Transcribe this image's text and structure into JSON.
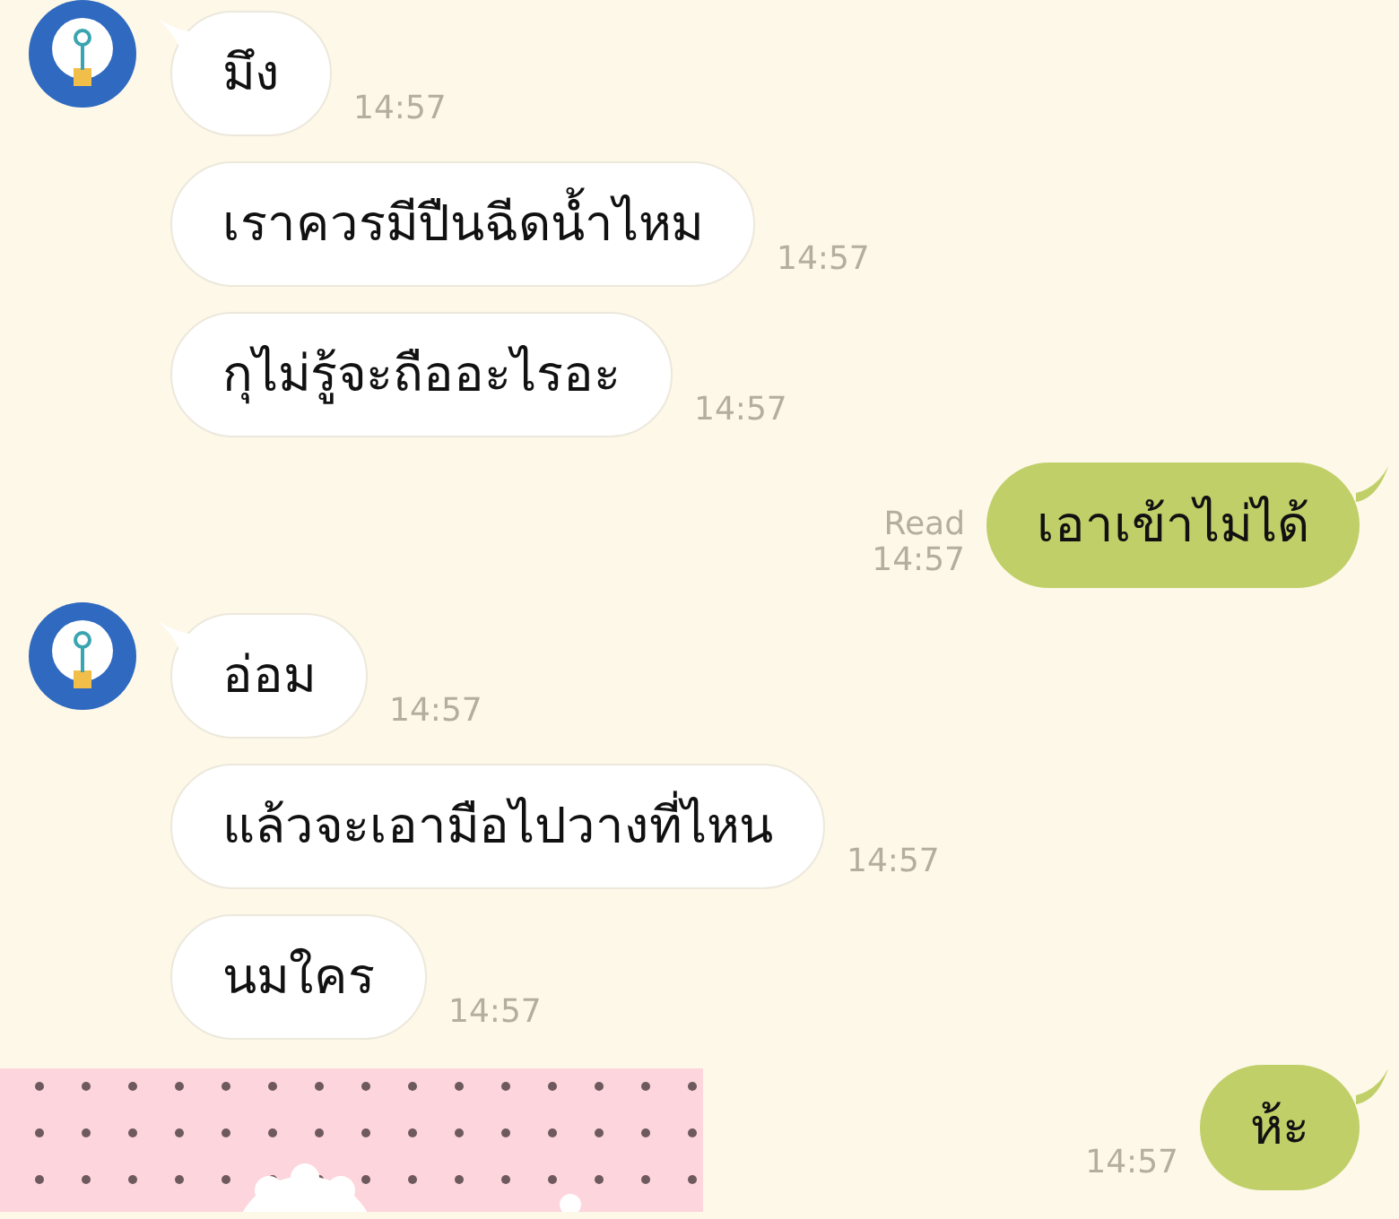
{
  "messages": [
    {
      "kind": "incoming",
      "avatar": true,
      "text": "มึง",
      "time": "14:57"
    },
    {
      "kind": "incoming",
      "avatar": false,
      "text": "เราควรมีปืนฉีดน้ำไหม",
      "time": "14:57"
    },
    {
      "kind": "incoming",
      "avatar": false,
      "text": "กุไม่รู้จะถืออะไรอะ",
      "time": "14:57"
    },
    {
      "kind": "outgoing",
      "tail": true,
      "read": "Read",
      "text": "เอาเข้าไม่ได้",
      "time": "14:57"
    },
    {
      "kind": "incoming",
      "avatar": true,
      "text": "อ่อม",
      "time": "14:57"
    },
    {
      "kind": "incoming",
      "avatar": false,
      "text": "แล้วจะเอามือไปวางที่ไหน",
      "time": "14:57"
    },
    {
      "kind": "incoming",
      "avatar": false,
      "text": "นมใคร",
      "time": "14:57"
    }
  ],
  "last_row": {
    "reply": {
      "kind": "outgoing",
      "tail": true,
      "text": "ห้ะ",
      "time": "14:57"
    }
  }
}
